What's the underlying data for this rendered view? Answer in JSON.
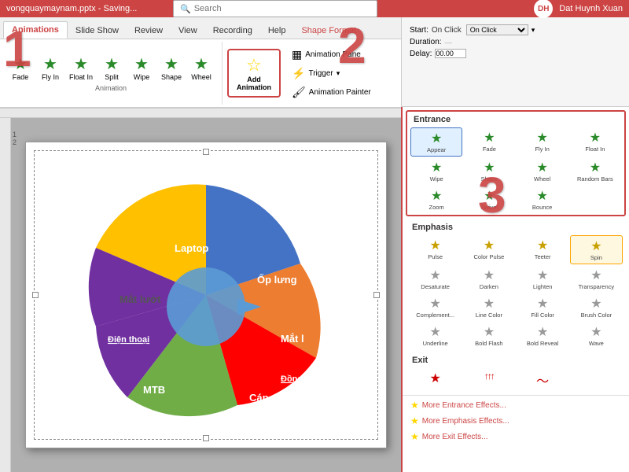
{
  "titlebar": {
    "filename": "vongquaymaynam.pptx - Saving...",
    "user": "Dat Huynh Xuan",
    "user_initials": "DH"
  },
  "search": {
    "placeholder": "Search"
  },
  "tabs": [
    {
      "label": "Animations",
      "active": true
    },
    {
      "label": "Slide Show"
    },
    {
      "label": "Review"
    },
    {
      "label": "View"
    },
    {
      "label": "Recording"
    },
    {
      "label": "Help"
    },
    {
      "label": "Shape Format",
      "accent": true
    }
  ],
  "ribbon": {
    "animation_group_label": "Animation",
    "animations": [
      {
        "label": "Fade"
      },
      {
        "label": "Fly In"
      },
      {
        "label": "Float In"
      },
      {
        "label": "Split"
      },
      {
        "label": "Wipe"
      },
      {
        "label": "Shape"
      },
      {
        "label": "Wheel"
      }
    ],
    "add_animation_label": "Add\nAnimation",
    "animation_pane_label": "Animation Pane",
    "trigger_label": "Trigger",
    "animation_painter_label": "Animation Painter"
  },
  "controls": {
    "start_label": "Start:",
    "start_value": "On Click",
    "duration_label": "Duration:",
    "duration_value": "",
    "delay_label": "Delay:",
    "delay_value": "00.00"
  },
  "anim_panel": {
    "entrance_title": "Entrance",
    "emphasis_title": "Emphasis",
    "exit_title": "Exit",
    "entrance_items": [
      {
        "label": "Appear",
        "icon": "★",
        "color": "green",
        "selected": true
      },
      {
        "label": "Fade",
        "icon": "★",
        "color": "green"
      },
      {
        "label": "Fly In",
        "icon": "★",
        "color": "green"
      },
      {
        "label": "Float In",
        "icon": "★",
        "color": "green"
      },
      {
        "label": "Wipe",
        "icon": "★",
        "color": "green"
      },
      {
        "label": "Shape",
        "icon": "★",
        "color": "green"
      },
      {
        "label": "Wheel",
        "icon": "★",
        "color": "green"
      },
      {
        "label": "Random Bars",
        "icon": "★",
        "color": "green"
      },
      {
        "label": "Zoom",
        "icon": "★",
        "color": "green"
      },
      {
        "label": "Swivel",
        "icon": "★",
        "color": "green"
      },
      {
        "label": "Bounce",
        "icon": "★",
        "color": "green"
      }
    ],
    "emphasis_items": [
      {
        "label": "Pulse",
        "icon": "★",
        "color": "yellow"
      },
      {
        "label": "Color Pulse",
        "icon": "★",
        "color": "yellow"
      },
      {
        "label": "Teeter",
        "icon": "★",
        "color": "yellow"
      },
      {
        "label": "Spin",
        "icon": "★",
        "color": "yellow",
        "selected": true
      },
      {
        "label": "Desaturate",
        "icon": "★",
        "color": "gray"
      },
      {
        "label": "Darken",
        "icon": "★",
        "color": "gray"
      },
      {
        "label": "Lighten",
        "icon": "★",
        "color": "gray"
      },
      {
        "label": "Transparency",
        "icon": "★",
        "color": "gray"
      },
      {
        "label": "Complement...",
        "icon": "★",
        "color": "gray"
      },
      {
        "label": "Line Color",
        "icon": "★",
        "color": "gray"
      },
      {
        "label": "Fill Color",
        "icon": "★",
        "color": "gray"
      },
      {
        "label": "Brush Color",
        "icon": "★",
        "color": "gray"
      },
      {
        "label": "Underline",
        "icon": "★",
        "color": "gray"
      },
      {
        "label": "Bold Flash",
        "icon": "★",
        "color": "gray"
      },
      {
        "label": "Bold Reveal",
        "icon": "★",
        "color": "gray"
      },
      {
        "label": "Wave",
        "icon": "★",
        "color": "gray"
      }
    ],
    "exit_items": [
      {
        "label": "",
        "icon": "★",
        "color": "red"
      },
      {
        "label": "",
        "icon": "↑↑↑",
        "color": "red"
      },
      {
        "label": "",
        "icon": "~",
        "color": "red"
      }
    ],
    "more_entrance": "More Entrance Effects...",
    "more_emphasis": "More Emphasis Effects...",
    "more_exit": "More Exit Effects..."
  },
  "slide": {
    "number": "1",
    "chart_segments": [
      {
        "label": "Laptop",
        "color": "#4472c4"
      },
      {
        "label": "Ốp lưng",
        "color": "#ed7d31"
      },
      {
        "label": "Mắt lướt",
        "color": "#ffc000"
      },
      {
        "label": "Mắt l",
        "color": "#ff0000"
      },
      {
        "label": "Đồng",
        "color": "#ff0000"
      },
      {
        "label": "Cáp sạc",
        "color": "#70ad47"
      },
      {
        "label": "MTB",
        "color": "#7030a0"
      },
      {
        "label": "Điện thoại",
        "color": "#7030a0"
      }
    ]
  },
  "annotations": {
    "one": "1",
    "two": "2",
    "three": "3"
  }
}
